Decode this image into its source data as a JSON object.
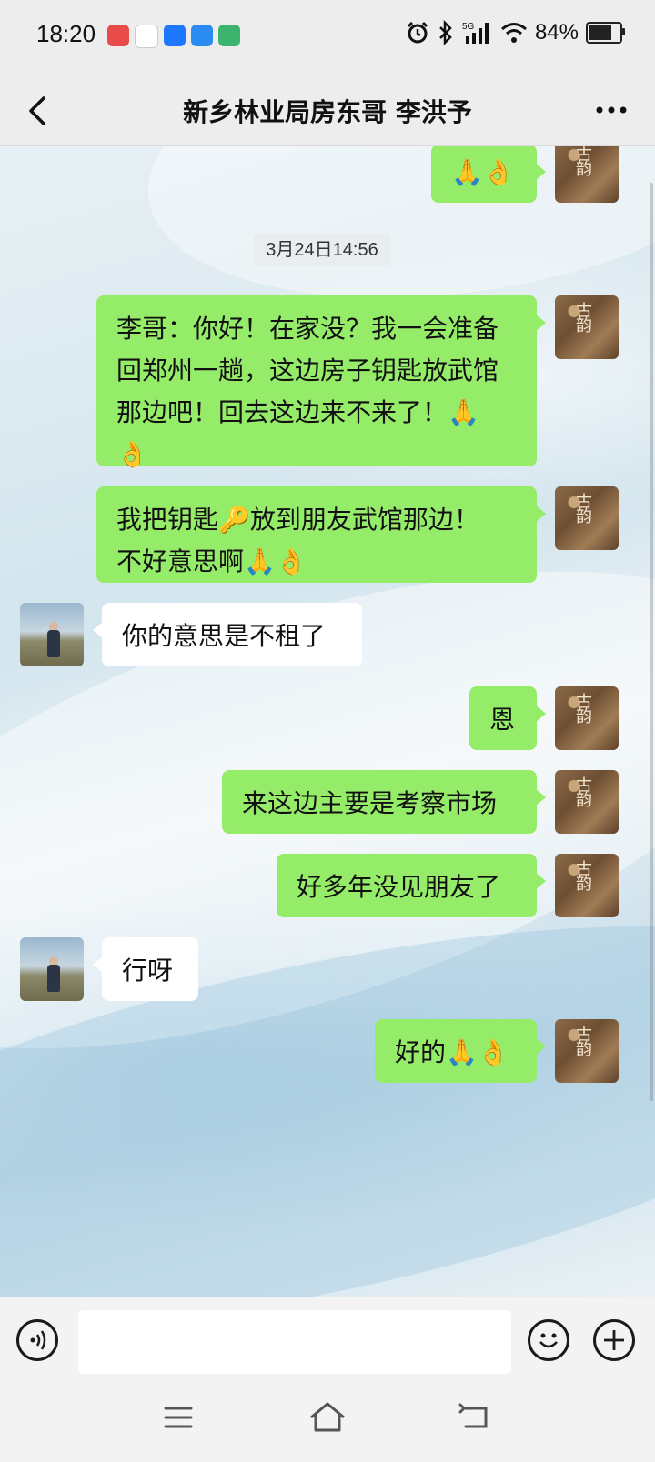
{
  "status_bar": {
    "time": "18:20",
    "battery_percent": "84%",
    "network": "5G",
    "battery_level": 0.84,
    "app_icon_colors": [
      "#e94a4a",
      "#ffffff",
      "#1e78ff",
      "#2a8cf0",
      "#3cb46e"
    ]
  },
  "header": {
    "title": "新乡林业局房东哥 李洪予",
    "back_icon": "chevron-left-icon",
    "more_icon": "more-dots-icon"
  },
  "chat": {
    "timestamp": "3月24日14:56",
    "messages": [
      {
        "from": "me",
        "text": "🙏👌"
      },
      {
        "from": "me",
        "lines": [
          "李哥：你好！在家没？我一会准备",
          "回郑州一趟，这边房子钥匙放武馆",
          "那边吧！回去这边来不来了！🙏",
          "👌"
        ]
      },
      {
        "from": "me",
        "lines": [
          "我把钥匙🔑放到朋友武馆那边！",
          "不好意思啊🙏👌"
        ]
      },
      {
        "from": "contact",
        "text": "你的意思是不租了"
      },
      {
        "from": "me",
        "text": "恩"
      },
      {
        "from": "me",
        "text": "来这边主要是考察市场"
      },
      {
        "from": "me",
        "text": "好多年没见朋友了"
      },
      {
        "from": "contact",
        "text": "行呀"
      },
      {
        "from": "me",
        "text": "好的🙏👌"
      }
    ],
    "my_avatar_text": "古 韵"
  },
  "input_bar": {
    "placeholder": "",
    "voice_icon": "voice-icon",
    "emoji_icon": "emoji-icon",
    "plus_icon": "plus-icon"
  },
  "colors": {
    "outgoing_bubble": "#95ec69",
    "incoming_bubble": "#ffffff",
    "header_bg": "#ededed"
  }
}
